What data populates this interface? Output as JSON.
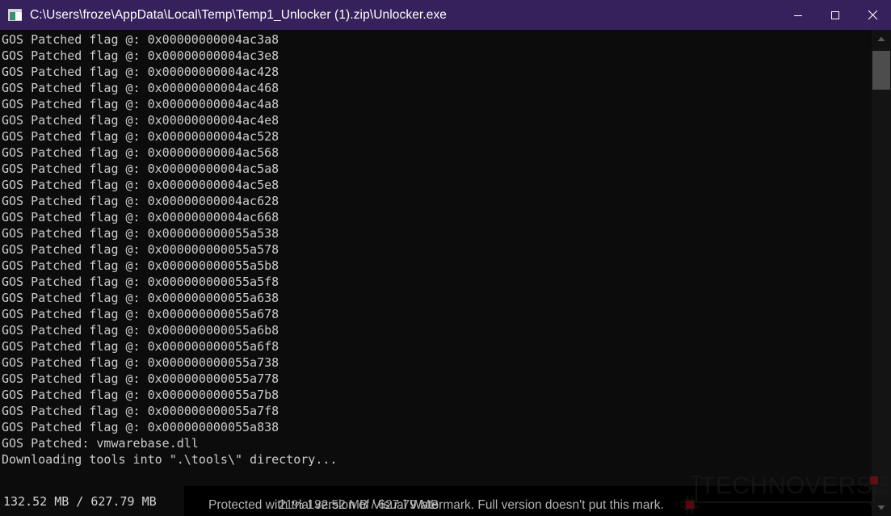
{
  "window": {
    "title": "C:\\Users\\froze\\AppData\\Local\\Temp\\Temp1_Unlocker (1).zip\\Unlocker.exe",
    "icon": "console-window-icon",
    "titlebar_color": "#36215c",
    "controls": {
      "minimize_label": "Minimize",
      "maximize_label": "Maximize",
      "close_label": "Close"
    }
  },
  "console": {
    "background_color": "#0c0c0c",
    "text_color": "#cccccc",
    "lines": [
      "GOS Patched flag @: 0x00000000004ac3a8",
      "GOS Patched flag @: 0x00000000004ac3e8",
      "GOS Patched flag @: 0x00000000004ac428",
      "GOS Patched flag @: 0x00000000004ac468",
      "GOS Patched flag @: 0x00000000004ac4a8",
      "GOS Patched flag @: 0x00000000004ac4e8",
      "GOS Patched flag @: 0x00000000004ac528",
      "GOS Patched flag @: 0x00000000004ac568",
      "GOS Patched flag @: 0x00000000004ac5a8",
      "GOS Patched flag @: 0x00000000004ac5e8",
      "GOS Patched flag @: 0x00000000004ac628",
      "GOS Patched flag @: 0x00000000004ac668",
      "GOS Patched flag @: 0x000000000055a538",
      "GOS Patched flag @: 0x000000000055a578",
      "GOS Patched flag @: 0x000000000055a5b8",
      "GOS Patched flag @: 0x000000000055a5f8",
      "GOS Patched flag @: 0x000000000055a638",
      "GOS Patched flag @: 0x000000000055a678",
      "GOS Patched flag @: 0x000000000055a6b8",
      "GOS Patched flag @: 0x000000000055a6f8",
      "GOS Patched flag @: 0x000000000055a738",
      "GOS Patched flag @: 0x000000000055a778",
      "GOS Patched flag @: 0x000000000055a7b8",
      "GOS Patched flag @: 0x000000000055a7f8",
      "GOS Patched flag @: 0x000000000055a838",
      "GOS Patched: vmwarebase.dll",
      "Downloading tools into \".\\tools\\\" directory..."
    ]
  },
  "status": {
    "downloaded": "132.52 MB",
    "separator": "/",
    "total": "627.79 MB",
    "text": "132.52 MB / 627.79 MB",
    "percent": "21%",
    "percent_value": 21,
    "overlay_text": "21%  132.52 MB / 627.79 MB"
  },
  "scrollbar": {
    "up_arrow": "chevron-up-icon",
    "down_arrow": "chevron-down-icon",
    "thumb_color": "#4d4d4d"
  },
  "watermarks": {
    "visual_watermark_text": "Protected with trial version of Visual Watermark. Full version doesn't put this mark.",
    "logo_text": "TECHNOVERSE",
    "logo_color": "#1b1b1b",
    "chip_color": "#8a1016"
  }
}
